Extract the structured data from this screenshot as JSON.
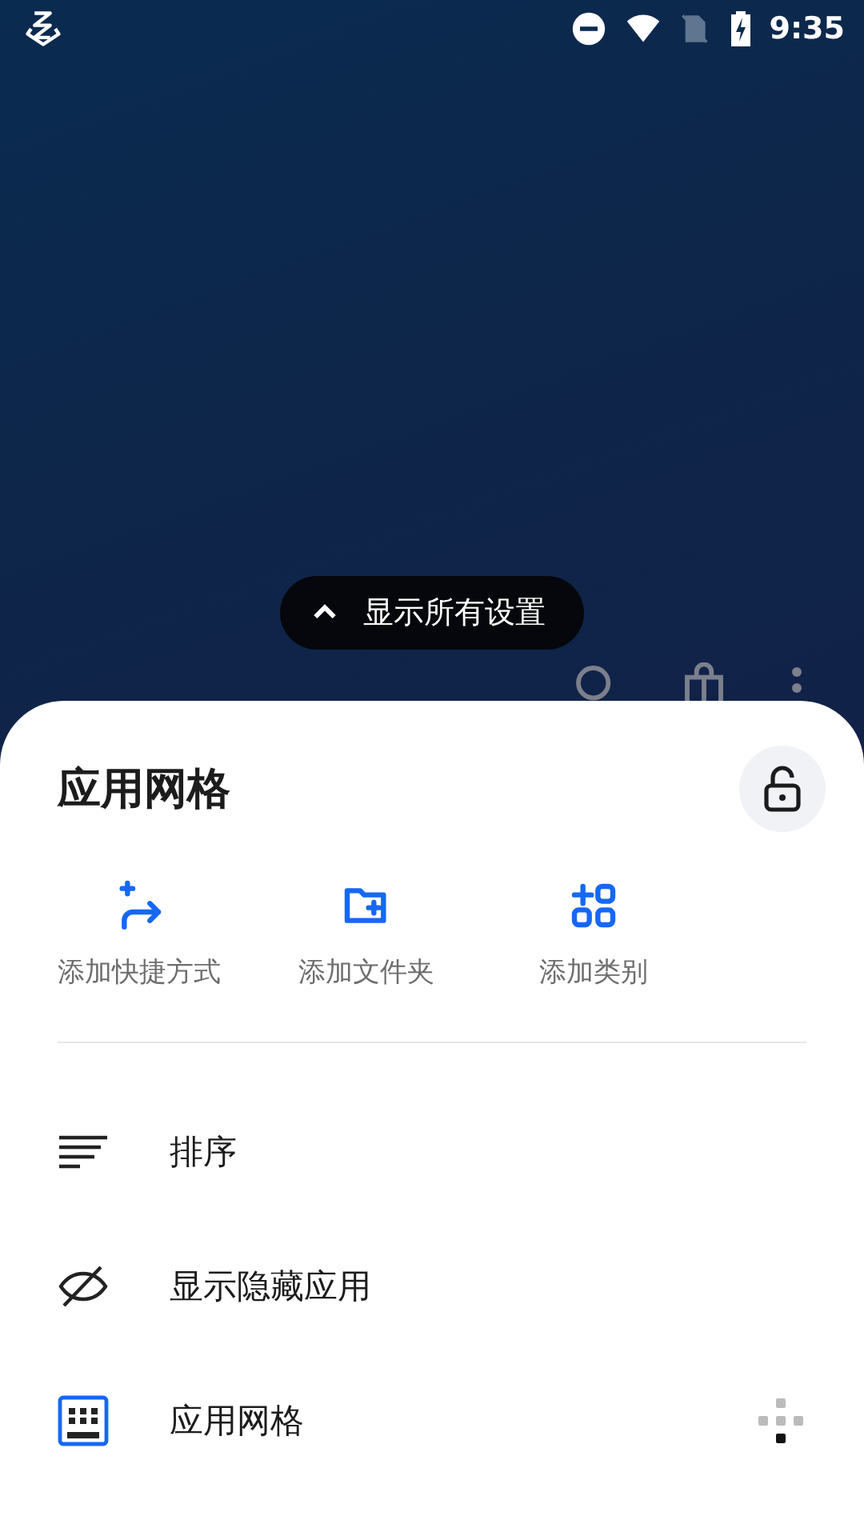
{
  "status_bar": {
    "time": "9:35"
  },
  "show_all_button": {
    "label": "显示所有设置"
  },
  "sheet": {
    "title": "应用网格",
    "locked": false,
    "actions": [
      {
        "kind": "shortcut",
        "label": "添加快捷方式"
      },
      {
        "kind": "folder",
        "label": "添加文件夹"
      },
      {
        "kind": "category",
        "label": "添加类别"
      }
    ],
    "items": [
      {
        "kind": "sort",
        "label": "排序"
      },
      {
        "kind": "hidden",
        "label": "显示隐藏应用"
      },
      {
        "kind": "grid",
        "label": "应用网格"
      }
    ]
  }
}
